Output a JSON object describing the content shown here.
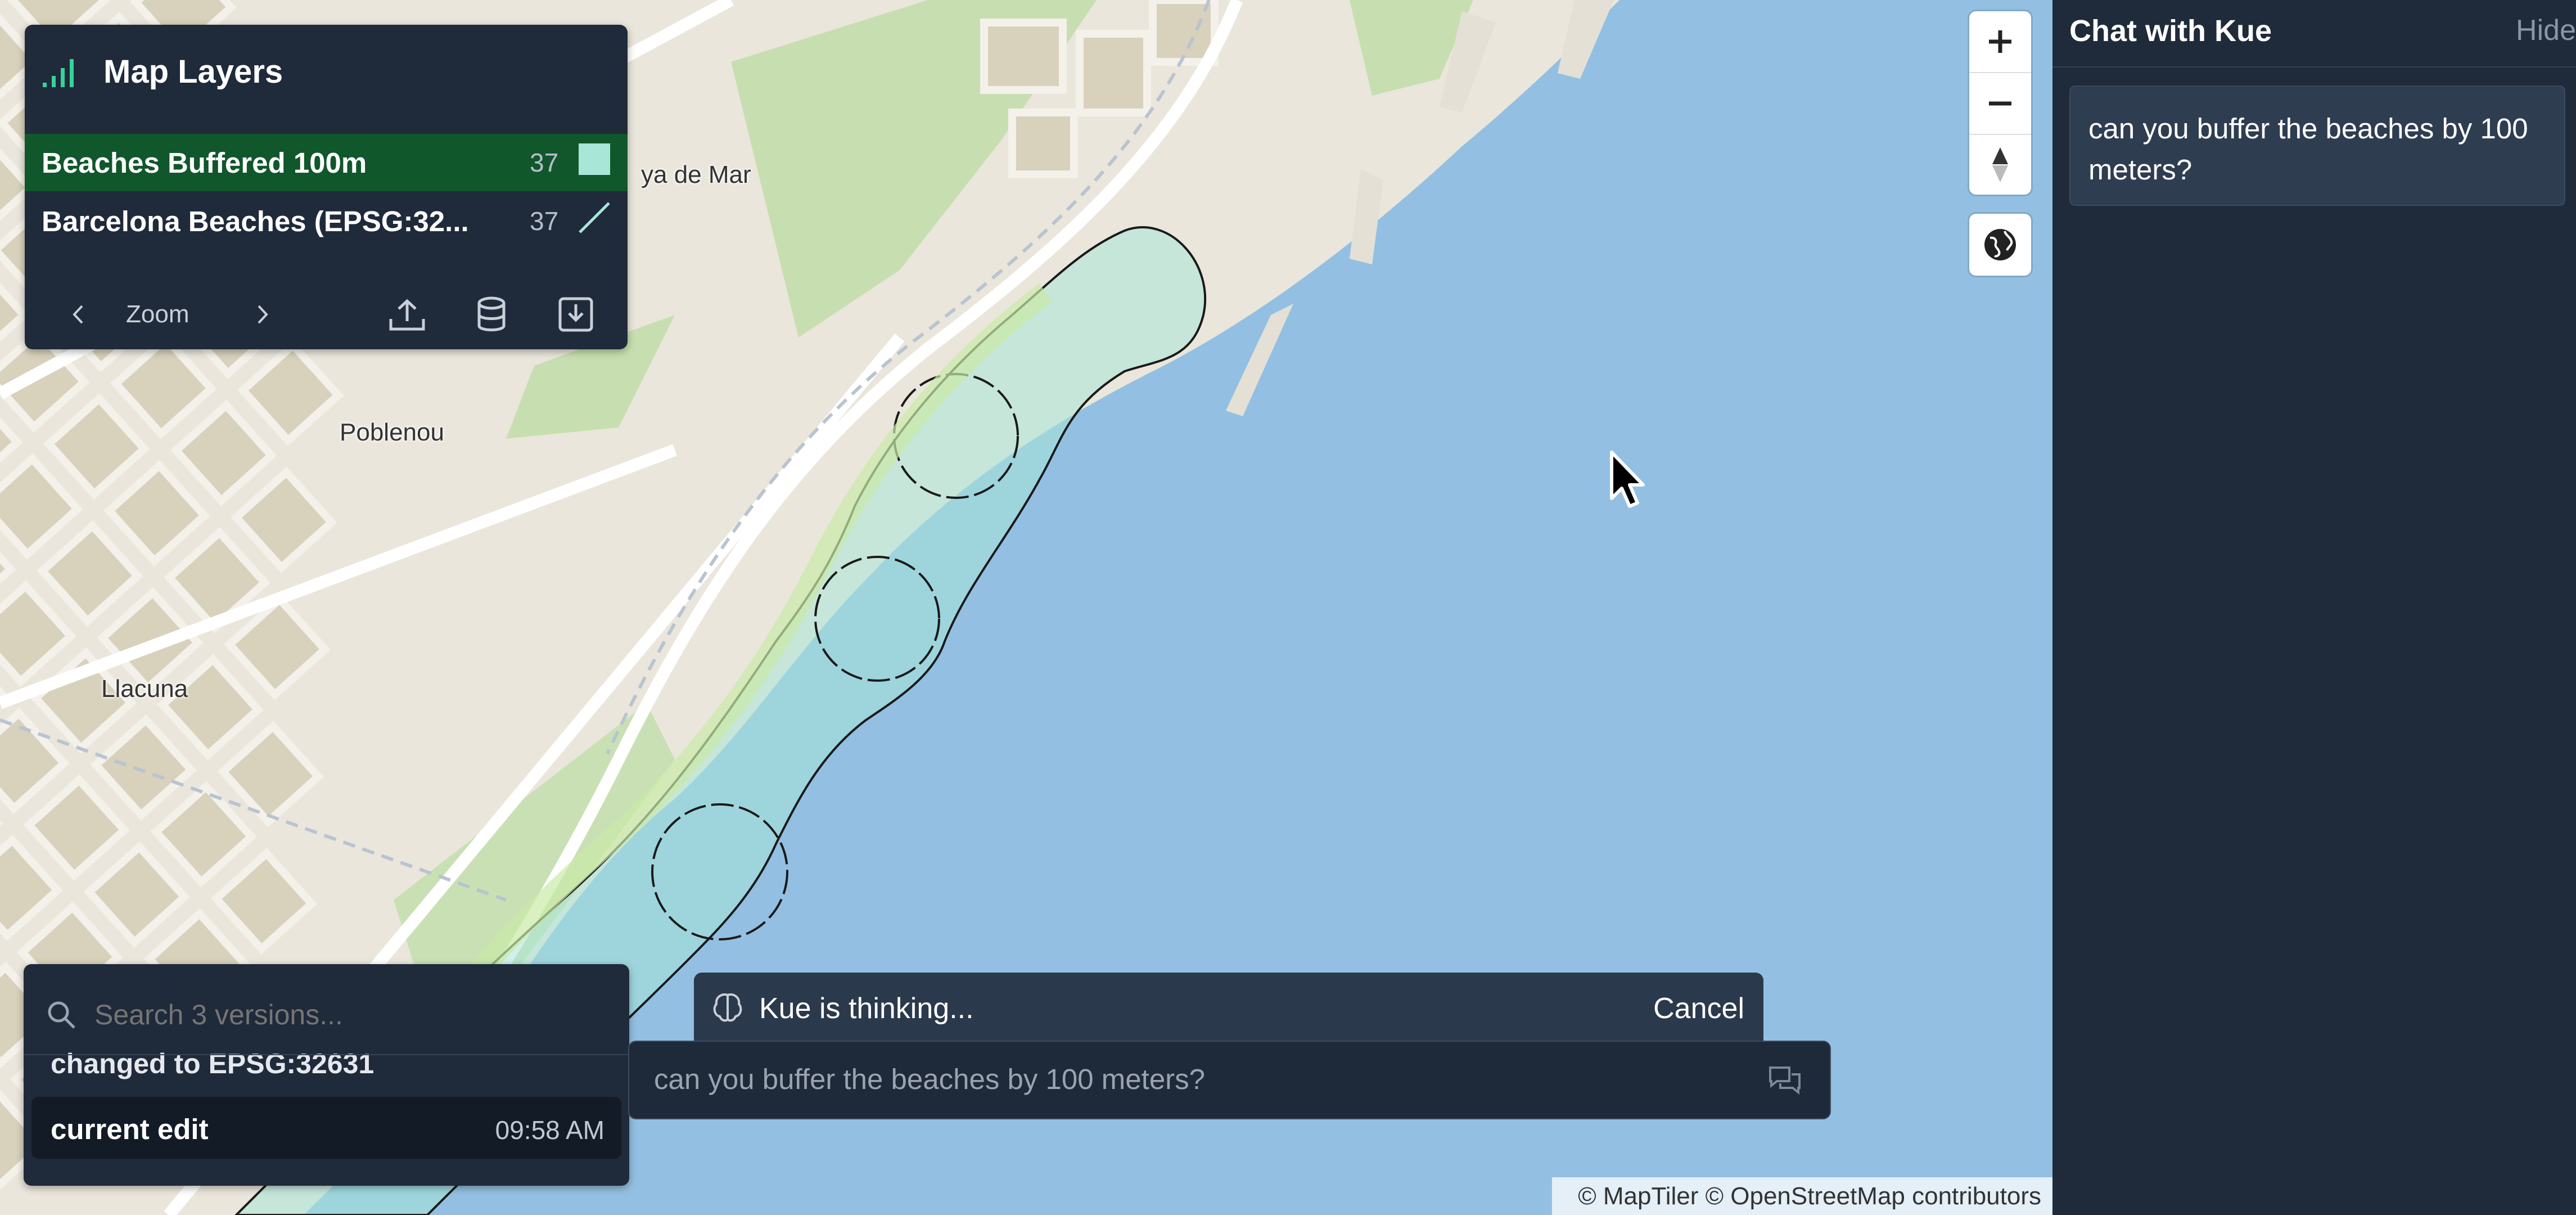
{
  "map": {
    "labels": [
      "Poblenou",
      "Llacuna",
      "ya de Mar"
    ],
    "attribution": "© MapTiler © OpenStreetMap contributors",
    "colors": {
      "sea": "#93c0e2",
      "land": "#eae6dc",
      "park": "#c7dfb0",
      "block": "#d8d1bc",
      "buffer": "#a8e6d8"
    }
  },
  "layers_panel": {
    "title": "Map Layers",
    "icon": "signal-bars-icon",
    "layers": [
      {
        "name": "Beaches Buffered 100m",
        "count": "37",
        "selected": true,
        "swatch": "polygon-swatch"
      },
      {
        "name": "Barcelona Beaches (EPSG:32...",
        "count": "37",
        "selected": false,
        "swatch": "line-swatch"
      }
    ],
    "zoom_label": "Zoom",
    "tools": [
      "chevron-left-icon",
      "chevron-right-icon",
      "upload-icon",
      "database-icon",
      "download-icon"
    ]
  },
  "versions_panel": {
    "search_placeholder": "Search 3 versions...",
    "previous_item": "changed to EPSG:32631",
    "current": {
      "label": "current edit",
      "time": "09:58 AM"
    }
  },
  "thinking": {
    "text": "Kue is thinking...",
    "cancel_label": "Cancel"
  },
  "prompt": {
    "value": "can you buffer the beaches by 100 meters?"
  },
  "chat": {
    "title": "Chat with Kue",
    "hide_label": "Hide",
    "messages": [
      {
        "role": "user",
        "text": "can you buffer the beaches by 100 meters?"
      }
    ]
  }
}
